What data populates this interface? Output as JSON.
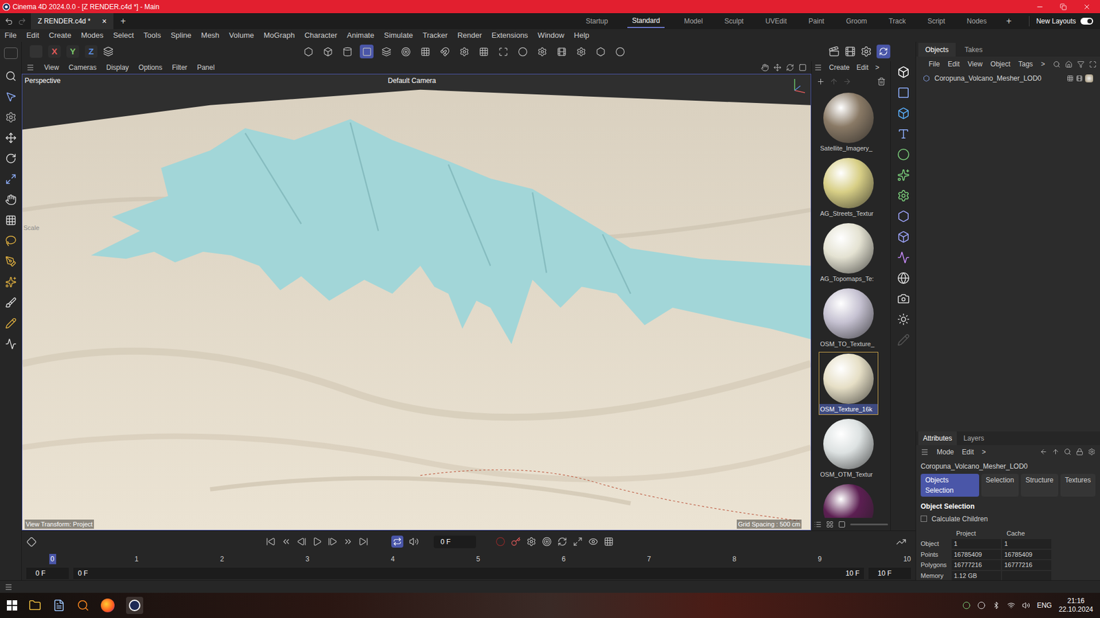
{
  "window": {
    "title": "Cinema 4D 2024.0.0 - [Z RENDER.c4d *] - Main"
  },
  "document_tab": {
    "label": "Z RENDER.c4d *",
    "close": "×",
    "add": "+"
  },
  "layouts": [
    {
      "label": "Startup",
      "selected": false
    },
    {
      "label": "Standard",
      "selected": true
    },
    {
      "label": "Model",
      "selected": false
    },
    {
      "label": "Sculpt",
      "selected": false
    },
    {
      "label": "UVEdit",
      "selected": false
    },
    {
      "label": "Paint",
      "selected": false
    },
    {
      "label": "Groom",
      "selected": false
    },
    {
      "label": "Track",
      "selected": false
    },
    {
      "label": "Script",
      "selected": false
    },
    {
      "label": "Nodes",
      "selected": false
    }
  ],
  "layouts_add": "+",
  "new_layouts": {
    "label": "New Layouts",
    "on": true
  },
  "menu": [
    "File",
    "Edit",
    "Create",
    "Modes",
    "Select",
    "Tools",
    "Spline",
    "Mesh",
    "Volume",
    "MoGraph",
    "Character",
    "Animate",
    "Simulate",
    "Tracker",
    "Render",
    "Extensions",
    "Window",
    "Help"
  ],
  "axis_buttons": [
    {
      "label": "X",
      "color": "#e05a5a"
    },
    {
      "label": "Y",
      "color": "#7cc36a"
    },
    {
      "label": "Z",
      "color": "#5a8ce0"
    }
  ],
  "viewport": {
    "menu": [
      "View",
      "Cameras",
      "Display",
      "Options",
      "Filter",
      "Panel"
    ],
    "label": "Perspective",
    "camera": "Default Camera",
    "view_transform": "View Transform: Project",
    "grid_spacing": "Grid Spacing : 500 cm",
    "tool_hint": "Scale"
  },
  "materials": {
    "menu": [
      "Create",
      "Edit",
      ">"
    ],
    "items": [
      {
        "name": "Satellite_Imagery_",
        "color": "#8a7a66",
        "selected": false
      },
      {
        "name": "AG_Streets_Textur",
        "color": "#d8cf86",
        "selected": false
      },
      {
        "name": "AG_Topomaps_Te:",
        "color": "#e4e2d2",
        "selected": false
      },
      {
        "name": "OSM_TO_Texture_",
        "color": "#c6c2d2",
        "selected": false
      },
      {
        "name": "OSM_Texture_16k",
        "color": "#e6dfc6",
        "selected": true
      },
      {
        "name": "OSM_OTM_Textur",
        "color": "#dde2e2",
        "selected": false
      },
      {
        "name": "",
        "color": "#5c1f52",
        "selected": false
      }
    ]
  },
  "objects": {
    "tabs": [
      {
        "label": "Objects",
        "selected": true
      },
      {
        "label": "Takes",
        "selected": false
      }
    ],
    "menu": [
      "File",
      "Edit",
      "View",
      "Object",
      "Tags",
      ">"
    ],
    "items": [
      {
        "name": "Coropuna_Volcano_Mesher_LOD0",
        "selected": false
      }
    ]
  },
  "attributes": {
    "tabs": [
      {
        "label": "Attributes",
        "selected": true
      },
      {
        "label": "Layers",
        "selected": false
      }
    ],
    "menu": [
      "Mode",
      "Edit",
      ">"
    ],
    "object_name": "Coropuna_Volcano_Mesher_LOD0",
    "buttons": [
      {
        "label": "Objects Selection",
        "selected": true
      },
      {
        "label": "Selection",
        "selected": false
      },
      {
        "label": "Structure",
        "selected": false
      },
      {
        "label": "Textures",
        "selected": false
      }
    ],
    "section": "Object Selection",
    "checkbox": {
      "label": "Calculate Children",
      "checked": false
    },
    "columns": [
      "Project",
      "Cache"
    ],
    "rows": [
      {
        "label": "Object",
        "values": [
          "1",
          "1"
        ]
      },
      {
        "label": "Points",
        "values": [
          "16785409",
          "16785409"
        ]
      },
      {
        "label": "Polygons",
        "values": [
          "16777216",
          "16777216"
        ]
      },
      {
        "label": "Memory",
        "values": [
          "1.12 GB",
          ""
        ]
      }
    ]
  },
  "timeline": {
    "current_frame": "0 F",
    "ruler": [
      "0",
      "1",
      "2",
      "3",
      "4",
      "5",
      "6",
      "7",
      "8",
      "9",
      "10"
    ],
    "start": "0 F",
    "preview_start": "0 F",
    "preview_end": "10 F",
    "end": "10 F"
  },
  "taskbar": {
    "language": "ENG",
    "time": "21:16",
    "date": "22.10.2024"
  }
}
